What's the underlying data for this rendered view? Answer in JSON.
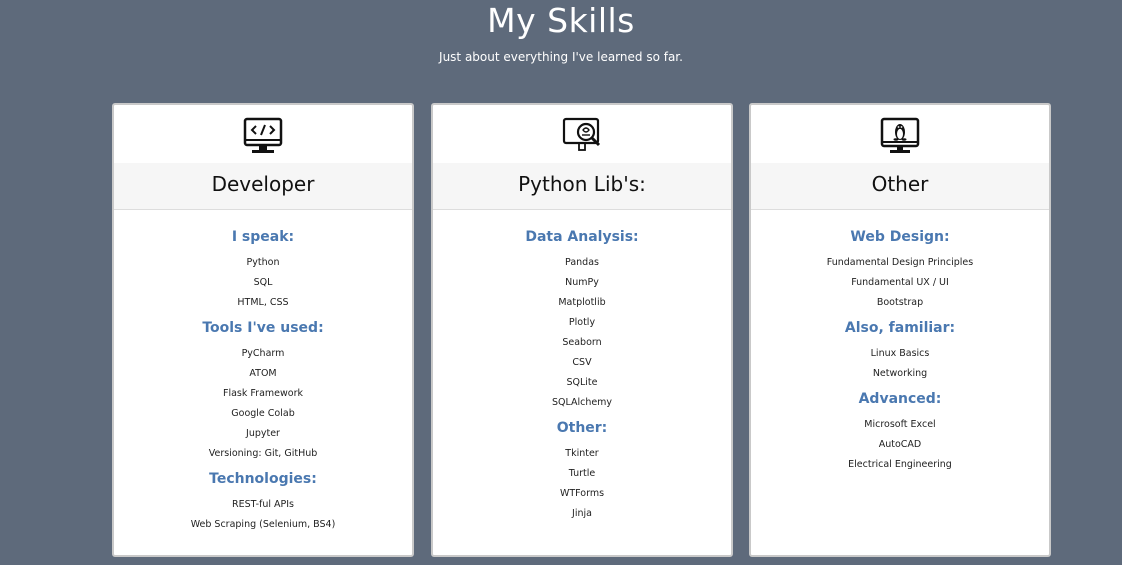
{
  "header": {
    "title": "My Skills",
    "subtitle": "Just about everything I've learned so far."
  },
  "cards": [
    {
      "icon": "monitor-code-icon",
      "title": "Developer",
      "groups": [
        {
          "title": "I speak:",
          "items": [
            "Python",
            "SQL",
            "HTML, CSS"
          ]
        },
        {
          "title": "Tools I've used:",
          "items": [
            "PyCharm",
            "ATOM",
            "Flask Framework",
            "Google Colab",
            "Jupyter",
            "Versioning: Git, GitHub"
          ]
        },
        {
          "title": "Technologies:",
          "items": [
            "REST-ful APIs",
            "Web Scraping (Selenium, BS4)"
          ]
        }
      ]
    },
    {
      "icon": "monitor-magnifier-icon",
      "title": "Python Lib's:",
      "groups": [
        {
          "title": "Data Analysis:",
          "items": [
            "Pandas",
            "NumPy",
            "Matplotlib",
            "Plotly",
            "Seaborn",
            "CSV",
            "SQLite",
            "SQLAlchemy"
          ]
        },
        {
          "title": "Other:",
          "items": [
            "Tkinter",
            "Turtle",
            "WTForms",
            "Jinja"
          ]
        }
      ]
    },
    {
      "icon": "monitor-linux-icon",
      "title": "Other",
      "groups": [
        {
          "title": "Web Design:",
          "items": [
            "Fundamental Design Principles",
            "Fundamental UX / UI",
            "Bootstrap"
          ]
        },
        {
          "title": "Also, familiar:",
          "items": [
            "Linux Basics",
            "Networking"
          ]
        },
        {
          "title": "Advanced:",
          "items": [
            "Microsoft Excel",
            "AutoCAD",
            "Electrical Engineering"
          ]
        }
      ]
    }
  ]
}
